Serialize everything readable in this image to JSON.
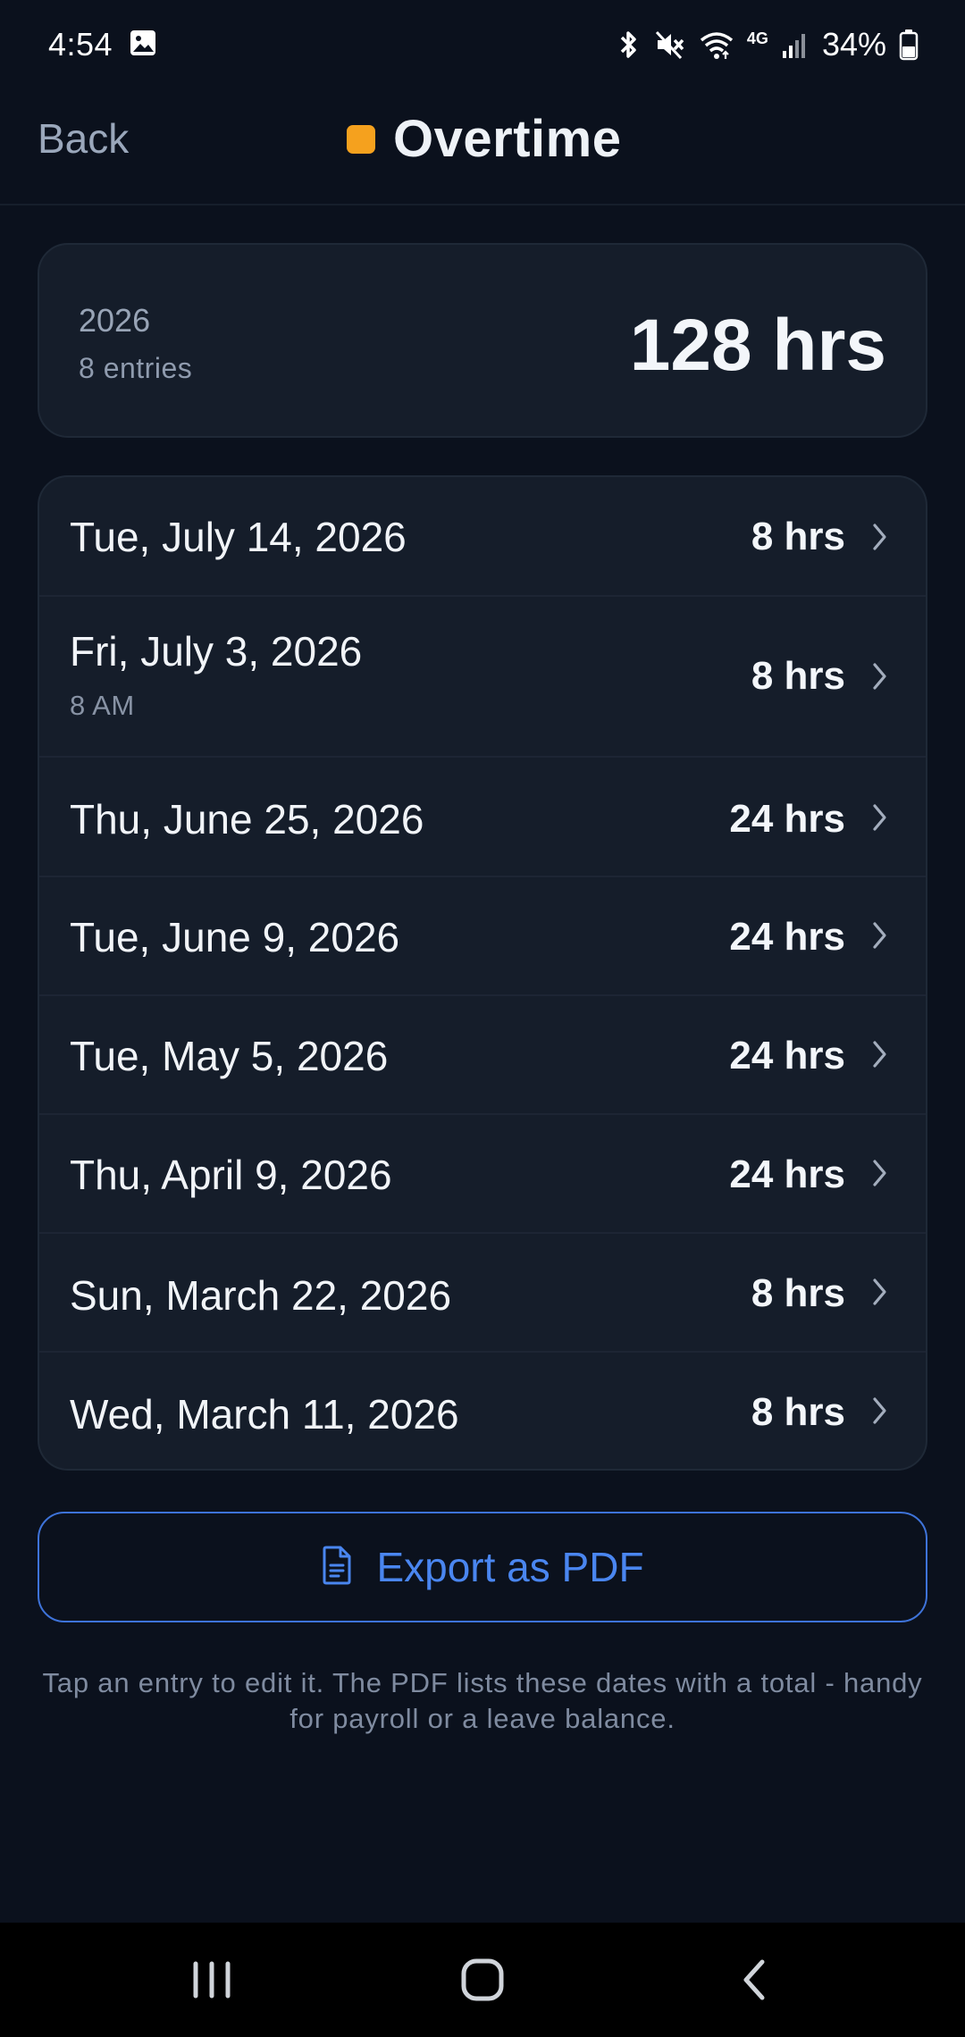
{
  "status_bar": {
    "time": "4:54",
    "battery_text": "34%",
    "network_label": "4G"
  },
  "header": {
    "back_label": "Back",
    "title": "Overtime",
    "dot_color": "#f5a11e"
  },
  "summary": {
    "year": "2026",
    "entries_label": "8 entries",
    "total": "128 hrs"
  },
  "entries": [
    {
      "date": "Tue, July 14, 2026",
      "time": "",
      "hours": "8 hrs"
    },
    {
      "date": "Fri, July 3, 2026",
      "time": "8 AM",
      "hours": "8 hrs"
    },
    {
      "date": "Thu, June 25, 2026",
      "time": "",
      "hours": "24 hrs"
    },
    {
      "date": "Tue, June 9, 2026",
      "time": "",
      "hours": "24 hrs"
    },
    {
      "date": "Tue, May 5, 2026",
      "time": "",
      "hours": "24 hrs"
    },
    {
      "date": "Thu, April 9, 2026",
      "time": "",
      "hours": "24 hrs"
    },
    {
      "date": "Sun, March 22, 2026",
      "time": "",
      "hours": "8 hrs"
    },
    {
      "date": "Wed, March 11, 2026",
      "time": "",
      "hours": "8 hrs"
    }
  ],
  "export": {
    "label": "Export as PDF",
    "icon": "document-icon"
  },
  "footer": {
    "note": "Tap an entry to edit it. The PDF lists these dates with a total - handy for payroll or a leave balance."
  },
  "colors": {
    "background": "#0b111d",
    "card": "#151d2a",
    "accent": "#4a86f0"
  }
}
